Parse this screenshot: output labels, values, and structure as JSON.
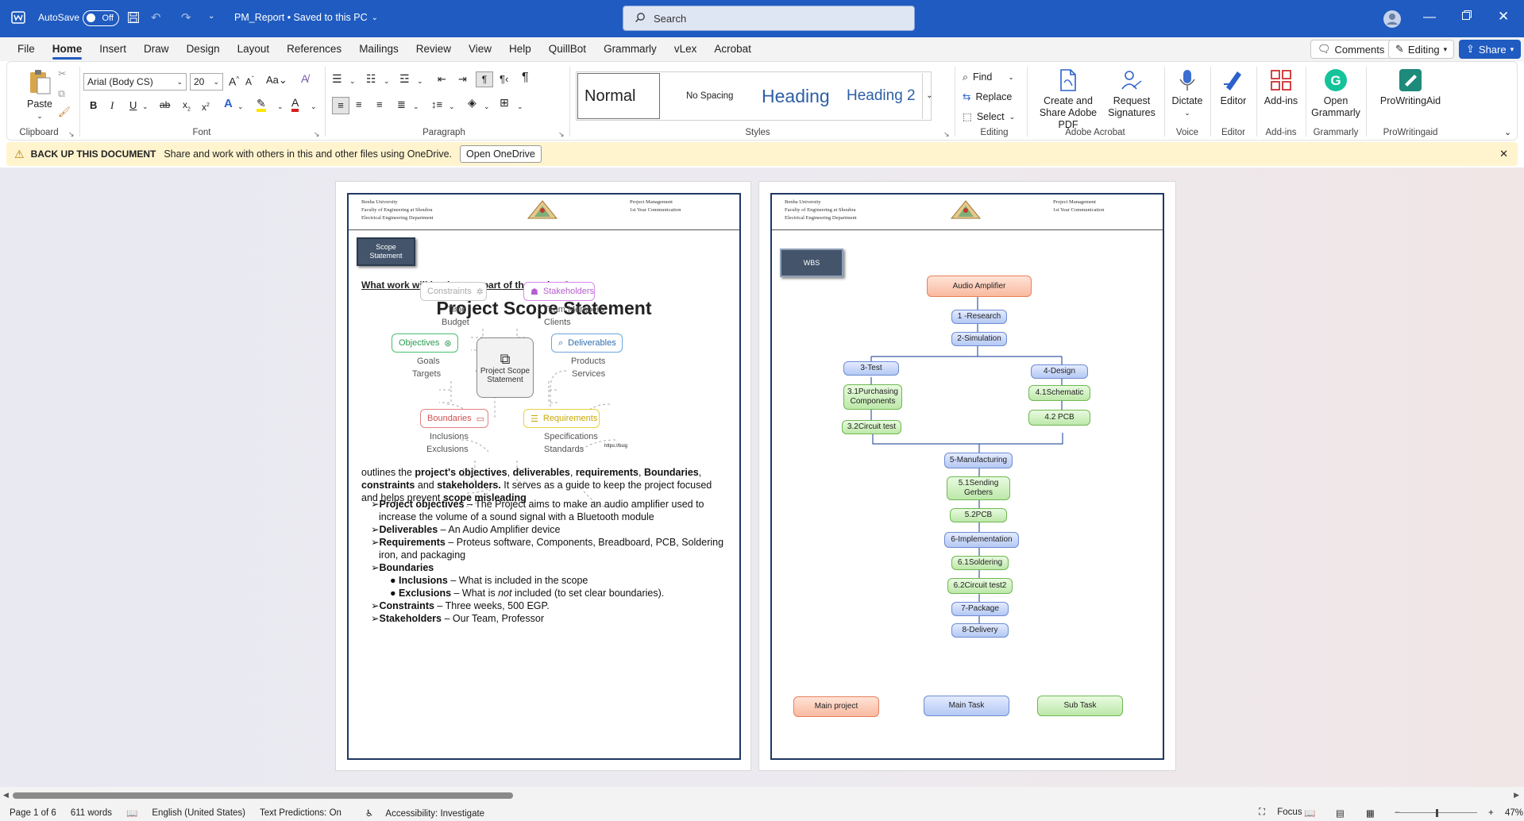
{
  "titlebar": {
    "autosave_label": "AutoSave",
    "autosave_state": "Off",
    "doc_title": "PM_Report • Saved to this PC",
    "search_placeholder": "Search"
  },
  "menu": [
    "File",
    "Home",
    "Insert",
    "Draw",
    "Design",
    "Layout",
    "References",
    "Mailings",
    "Review",
    "View",
    "Help",
    "QuillBot",
    "Grammarly",
    "vLex",
    "Acrobat"
  ],
  "menu_active": "Home",
  "menu_right": {
    "comments": "Comments",
    "editing": "Editing",
    "share": "Share"
  },
  "ribbon": {
    "clipboard": {
      "paste": "Paste",
      "label": "Clipboard"
    },
    "font": {
      "name": "Arial (Body CS)",
      "size": "20",
      "label": "Font"
    },
    "paragraph": {
      "label": "Paragraph"
    },
    "styles": {
      "items": [
        "Normal",
        "No Spacing",
        "Heading",
        "Heading 2"
      ],
      "label": "Styles"
    },
    "editing": {
      "find": "Find",
      "replace": "Replace",
      "select": "Select",
      "label": "Editing"
    },
    "acrobat": {
      "create": "Create and Share Adobe PDF",
      "request": "Request Signatures",
      "label": "Adobe Acrobat"
    },
    "voice": {
      "dictate": "Dictate",
      "label": "Voice"
    },
    "editor": {
      "btn": "Editor",
      "label": "Editor"
    },
    "addins": {
      "btn": "Add-ins",
      "label": "Add-ins"
    },
    "grammarly": {
      "btn": "Open Grammarly",
      "label": "Grammarly"
    },
    "pwa": {
      "btn": "ProWritingAid",
      "label": "ProWritingaid"
    }
  },
  "infobar": {
    "title": "BACK UP THIS DOCUMENT",
    "text": "Share and work with others in this and other files using OneDrive.",
    "button": "Open OneDrive"
  },
  "page1": {
    "header_left": [
      "Benha University",
      "Faculty of Engineering at Shoubra",
      "Electrical Engineering Department"
    ],
    "header_right": [
      "Project Management",
      "1st Year Communication"
    ],
    "tag": "Scope Statement",
    "question": "What work will be done as part of the project?",
    "title": "Project Scope Statement",
    "center": "Project Scope Statement",
    "constraints": {
      "label": "Constraints",
      "items": [
        "Time",
        "Budget"
      ]
    },
    "stakeholders": {
      "label": "Stakeholders",
      "items": [
        "Team Members",
        "Clients"
      ]
    },
    "objectives": {
      "label": "Objectives",
      "items": [
        "Goals",
        "Targets"
      ]
    },
    "deliverables": {
      "label": "Deliverables",
      "items": [
        "Products",
        "Services"
      ]
    },
    "boundaries": {
      "label": "Boundaries",
      "items": [
        "Inclusions",
        "Exclusions"
      ]
    },
    "requirements": {
      "label": "Requirements",
      "items": [
        "Specifications",
        "Standards"
      ]
    },
    "url_snippet": "https://bsig",
    "para_1": "outlines the ",
    "para_b1": "project's objectives",
    "para_2": ", ",
    "para_b2": "deliverables",
    "para_3": ", ",
    "para_b3": "requirements",
    "para_4": ", ",
    "para_b4": "Boundaries",
    "para_5": ", ",
    "para_b5": "constraints",
    "para_6": " and ",
    "para_b6": "stakeholders.",
    "para_7": " It serves as a guide to keep the project focused and helps prevent ",
    "para_b7": "scope misleading",
    "bullets": [
      {
        "b": "Project objectives",
        "t": " – The Project aims to make an audio amplifier used to increase the volume of a sound signal with a Bluetooth module"
      },
      {
        "b": "Deliverables",
        "t": " – An Audio Amplifier device"
      },
      {
        "b": "Requirements",
        "t": " – Proteus software, Components, Breadboard, PCB, Soldering iron, and packaging"
      },
      {
        "b": "Boundaries",
        "t": ""
      },
      {
        "b": "Constraints",
        "t": " – Three weeks, 500 EGP."
      },
      {
        "b": "Stakeholders",
        "t": " – Our Team, Professor"
      }
    ],
    "sub_bullets": [
      {
        "b": "Inclusions",
        "t": " – What is included in the scope"
      },
      {
        "b": "Exclusions",
        "t1": " – What is ",
        "i": "not",
        "t2": " included (to set clear boundaries)."
      }
    ]
  },
  "page2": {
    "header_left": [
      "Benha University",
      "Faculty of Engineering at Shoubra",
      "Electrical Engineering Department"
    ],
    "header_right": [
      "Project Management",
      "1st Year Communication"
    ],
    "tag": "WBS",
    "nodes": {
      "root": "Audio Amplifier",
      "n1": "1 -Research",
      "n2": "2-Simulation",
      "n3": "3-Test",
      "n31": "3.1Purchasing Components",
      "n32": "3.2Circuit test",
      "n4": "4-Design",
      "n41": "4.1Schematic",
      "n42": "4.2 PCB",
      "n5": "5-Manufacturing",
      "n51": "5.1Sending Gerbers",
      "n52": "5.2PCB",
      "n6": "6-Implementation",
      "n61": "6.1Soldering",
      "n62": "6.2Circuit test2",
      "n7": "7-Package",
      "n8": "8-Delivery"
    },
    "legend": [
      "Main project",
      "Main Task",
      "Sub Task"
    ]
  },
  "status": {
    "page": "Page 1 of 6",
    "words": "611 words",
    "language": "English (United States)",
    "predictions": "Text Predictions: On",
    "accessibility": "Accessibility: Investigate",
    "focus": "Focus",
    "zoom": "47%"
  },
  "colors": {
    "brand": "#1f5bc0",
    "infobar": "#fff4ce"
  }
}
